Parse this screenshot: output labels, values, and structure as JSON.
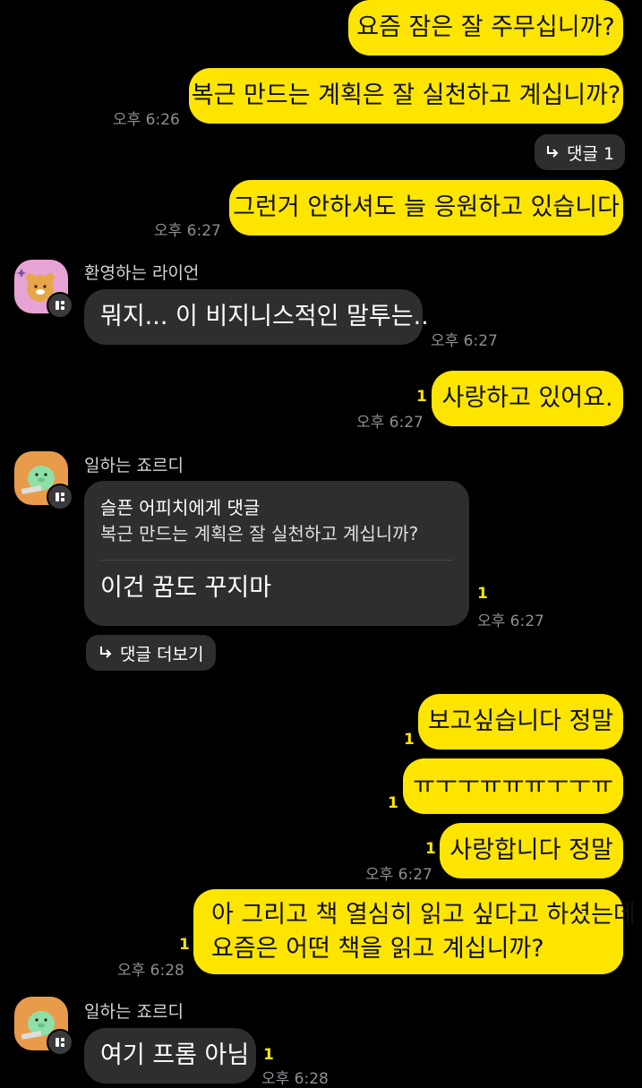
{
  "messages": {
    "m1": {
      "text": "요즘 잠은 잘 주무십니까?"
    },
    "m2": {
      "text": "복근 만드는 계획은 잘 실천하고 계십니까?",
      "time": "오후 6:26"
    },
    "comment_chip": {
      "label": "댓글 1"
    },
    "m3": {
      "text": "그런거 안하셔도 늘 응원하고 있습니다",
      "time": "오후 6:27"
    },
    "lion": {
      "sender": "환영하는 라이언",
      "text": "뭐지... 이 비지니스적인 말투는..",
      "time": "오후 6:27"
    },
    "m4": {
      "text": "사랑하고 있어요.",
      "unread": "1",
      "time": "오후 6:27"
    },
    "jordy1": {
      "sender": "일하는 죠르디",
      "reply_to": "슬픈 어피치에게 댓글",
      "quote": "복근 만드는 계획은 잘 실천하고 계십니까?",
      "text": "이건 꿈도 꾸지마",
      "unread": "1",
      "time": "오후 6:27"
    },
    "more_chip": {
      "label": "댓글 더보기"
    },
    "m5": {
      "text": "보고싶습니다 정말",
      "unread": "1"
    },
    "m6": {
      "text": "ㅠㅜㅜㅠㅠㅠㅜㅜㅠ",
      "unread": "1"
    },
    "m7": {
      "text": "사랑합니다 정말",
      "unread": "1",
      "time": "오후 6:27"
    },
    "m8": {
      "line1": "아 그리고 책 열심히 읽고 싶다고 하셨는데",
      "line2": "요즘은 어떤 책을 읽고 계십니까?",
      "unread": "1",
      "time": "오후 6:28"
    },
    "jordy2": {
      "sender": "일하는 죠르디",
      "text": "여기 프롬 아님",
      "unread": "1",
      "time": "오후 6:28"
    }
  },
  "colors": {
    "outgoing": "#FEE500",
    "incoming": "#2E2E30",
    "background": "#000000",
    "unread": "#FEE500"
  }
}
